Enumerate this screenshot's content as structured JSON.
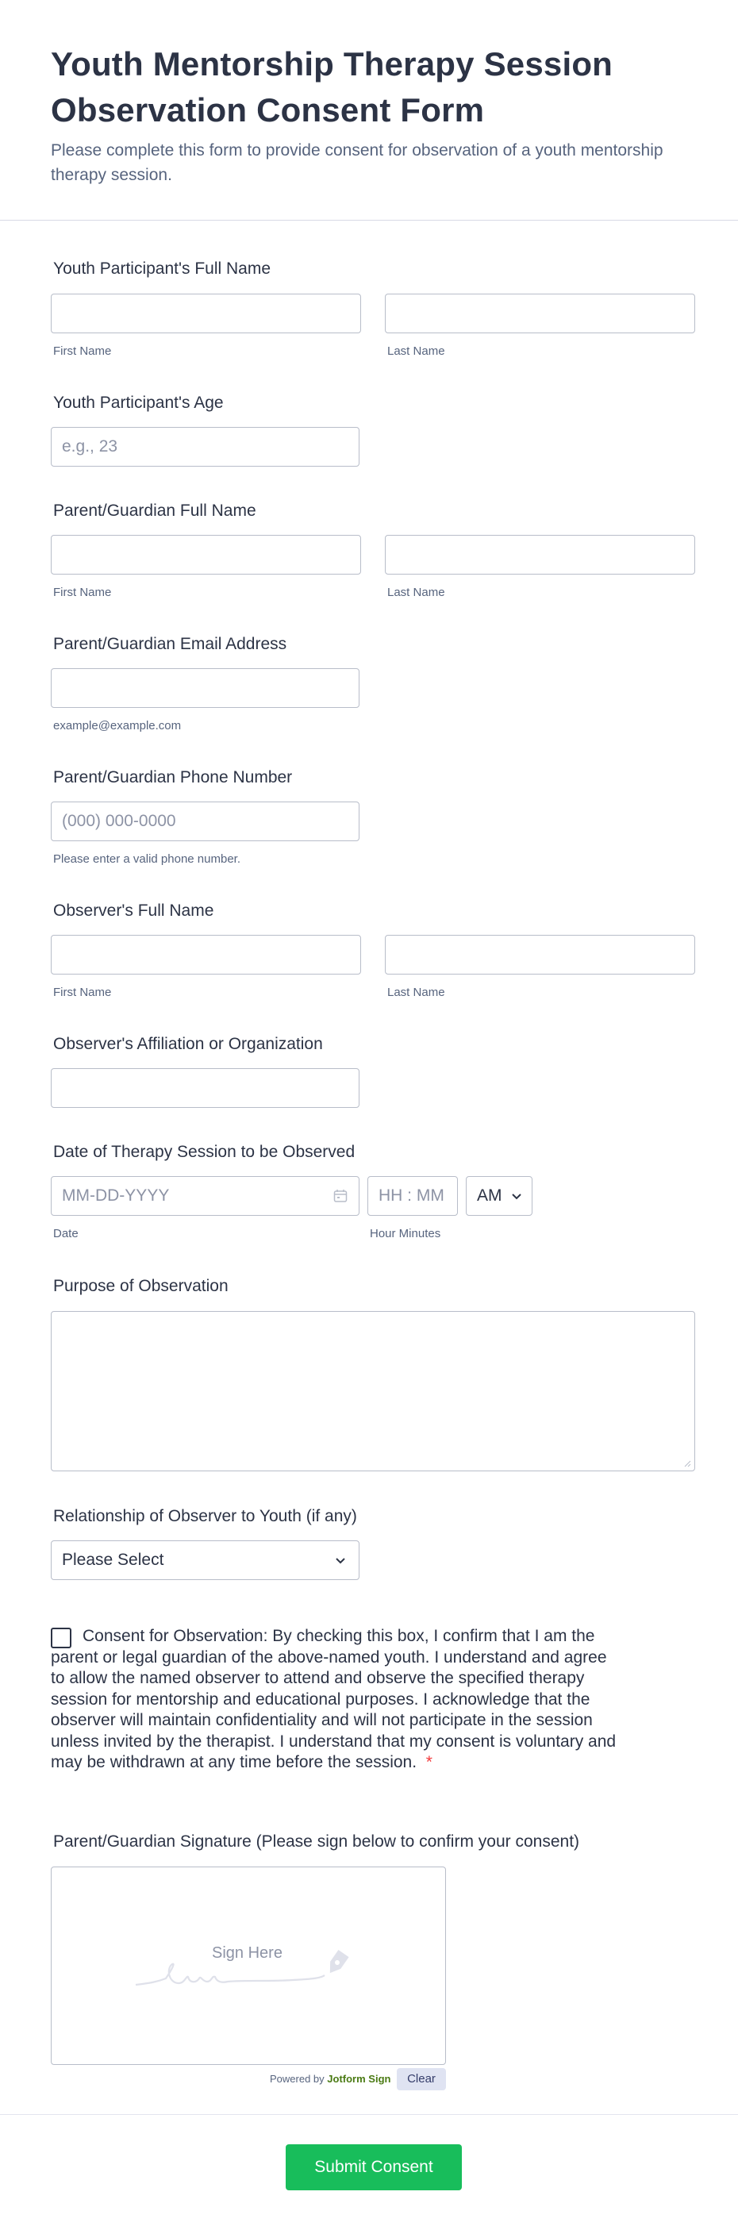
{
  "form": {
    "title": "Youth Mentorship Therapy Session Observation Consent Form",
    "subtitle": "Please complete this form to provide consent for observation of a youth mentorship therapy session."
  },
  "youth_name": {
    "label": "Youth Participant's Full Name",
    "first_sub": "First Name",
    "last_sub": "Last Name"
  },
  "youth_age": {
    "label": "Youth Participant's Age",
    "placeholder": "e.g., 23"
  },
  "guardian_name": {
    "label": "Parent/Guardian Full Name",
    "first_sub": "First Name",
    "last_sub": "Last Name"
  },
  "guardian_email": {
    "label": "Parent/Guardian Email Address",
    "sub": "example@example.com"
  },
  "guardian_phone": {
    "label": "Parent/Guardian Phone Number",
    "placeholder": "(000) 000-0000",
    "sub": "Please enter a valid phone number."
  },
  "observer_name": {
    "label": "Observer's Full Name",
    "first_sub": "First Name",
    "last_sub": "Last Name"
  },
  "observer_affiliation": {
    "label": "Observer's Affiliation or Organization"
  },
  "session_date": {
    "label": "Date of Therapy Session to be Observed",
    "date_placeholder": "MM-DD-YYYY",
    "time_placeholder": "HH : MM",
    "ampm": "AM",
    "date_sub": "Date",
    "time_sub": "Hour Minutes"
  },
  "purpose": {
    "label": "Purpose of Observation"
  },
  "relationship": {
    "label": "Relationship of Observer to Youth (if any)",
    "selected": "Please Select"
  },
  "consent": {
    "text": "Consent for Observation: By checking this box, I confirm that I am the parent or legal guardian of the above-named youth. I understand and agree to allow the named observer to attend and observe the specified therapy session for mentorship and educational purposes. I acknowledge that the observer will maintain confidentiality and will not participate in the session unless invited by the therapist. I understand that my consent is voluntary and may be withdrawn at any time before the session.",
    "required_mark": "*"
  },
  "signature": {
    "label": "Parent/Guardian Signature (Please sign below to confirm your consent)",
    "placeholder": "Sign Here",
    "powered_prefix": "Powered by",
    "powered_brand": "Jotform Sign",
    "clear_label": "Clear"
  },
  "submit_label": "Submit Consent",
  "colors": {
    "accent": "#18bd5b",
    "text": "#2c3345",
    "muted": "#57647e",
    "border": "#b8bdc9",
    "required": "#f23a3c"
  }
}
